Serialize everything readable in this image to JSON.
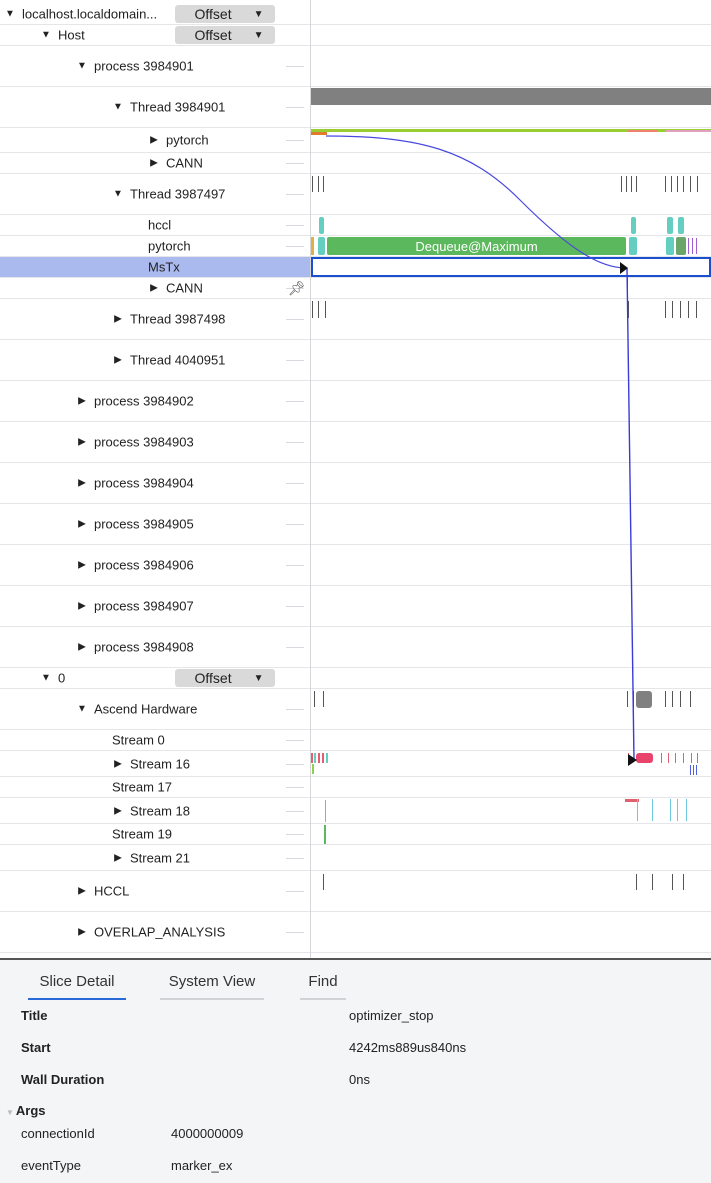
{
  "tree": [
    {
      "key": "r0",
      "label": "localhost.localdomain...",
      "depth": 0,
      "expand": "open",
      "offset": true
    },
    {
      "key": "r1",
      "label": "Host",
      "depth": 1,
      "expand": "open",
      "offset": true
    },
    {
      "key": "r2",
      "label": "process 3984901",
      "depth": 2,
      "expand": "open"
    },
    {
      "key": "r3",
      "label": "Thread 3984901",
      "depth": 3,
      "expand": "open"
    },
    {
      "key": "r4",
      "label": "pytorch",
      "depth": 4,
      "expand": "closed"
    },
    {
      "key": "r5",
      "label": "CANN",
      "depth": 4,
      "expand": "closed"
    },
    {
      "key": "r6",
      "label": "Thread 3987497",
      "depth": 3,
      "expand": "open"
    },
    {
      "key": "r7",
      "label": "hccl",
      "depth": 4,
      "expand": "none"
    },
    {
      "key": "r8",
      "label": "pytorch",
      "depth": 4,
      "expand": "none"
    },
    {
      "key": "r9",
      "label": "MsTx",
      "depth": 4,
      "expand": "none",
      "selected": true
    },
    {
      "key": "r10",
      "label": "CANN",
      "depth": 4,
      "expand": "closed"
    },
    {
      "key": "r11",
      "label": "Thread 3987498",
      "depth": 3,
      "expand": "closed"
    },
    {
      "key": "r12",
      "label": "Thread 4040951",
      "depth": 3,
      "expand": "closed"
    },
    {
      "key": "r13",
      "label": "process 3984902",
      "depth": 2,
      "expand": "closed"
    },
    {
      "key": "r14",
      "label": "process 3984903",
      "depth": 2,
      "expand": "closed"
    },
    {
      "key": "r15",
      "label": "process 3984904",
      "depth": 2,
      "expand": "closed"
    },
    {
      "key": "r16",
      "label": "process 3984905",
      "depth": 2,
      "expand": "closed"
    },
    {
      "key": "r17",
      "label": "process 3984906",
      "depth": 2,
      "expand": "closed"
    },
    {
      "key": "r18",
      "label": "process 3984907",
      "depth": 2,
      "expand": "closed"
    },
    {
      "key": "r19",
      "label": "process 3984908",
      "depth": 2,
      "expand": "closed"
    },
    {
      "key": "r20",
      "label": "0",
      "depth": 1,
      "expand": "open",
      "offset": true
    },
    {
      "key": "r21",
      "label": "Ascend Hardware",
      "depth": 2,
      "expand": "open"
    },
    {
      "key": "r22",
      "label": "Stream 0",
      "depth": 3,
      "expand": "none"
    },
    {
      "key": "r23",
      "label": "Stream 16",
      "depth": 3,
      "expand": "closed"
    },
    {
      "key": "r24",
      "label": "Stream 17",
      "depth": 3,
      "expand": "none"
    },
    {
      "key": "r25",
      "label": "Stream 18",
      "depth": 3,
      "expand": "closed"
    },
    {
      "key": "r26",
      "label": "Stream 19",
      "depth": 3,
      "expand": "none"
    },
    {
      "key": "r27",
      "label": "Stream 21",
      "depth": 3,
      "expand": "closed"
    },
    {
      "key": "r28",
      "label": "HCCL",
      "depth": 2,
      "expand": "closed"
    },
    {
      "key": "r29",
      "label": "OVERLAP_ANALYSIS",
      "depth": 2,
      "expand": "closed"
    }
  ],
  "offset_label": "Offset",
  "slice_label": "Dequeue@Maximum",
  "colors": {
    "green": "#5cb85c",
    "teal": "#64cfc0",
    "gray": "#808080",
    "pink": "#e8436a",
    "flow": "#4040e0",
    "selected": "#aab9ee",
    "selectedBorder": "#1a4fcf"
  },
  "icons": {
    "expanded": "triangle-down-icon",
    "collapsed": "triangle-right-icon",
    "pin": "pin-icon"
  },
  "panel": {
    "tabs": [
      "Slice Detail",
      "System View",
      "Find"
    ],
    "fields": [
      {
        "key": "Title",
        "value": "optimizer_stop"
      },
      {
        "key": "Start",
        "value": "4242ms889us840ns"
      },
      {
        "key": "Wall Duration",
        "value": "0ns"
      }
    ],
    "args_heading": "Args",
    "args": [
      {
        "key": "connectionId",
        "value": "4000000009"
      },
      {
        "key": "eventType",
        "value": "marker_ex"
      }
    ]
  }
}
